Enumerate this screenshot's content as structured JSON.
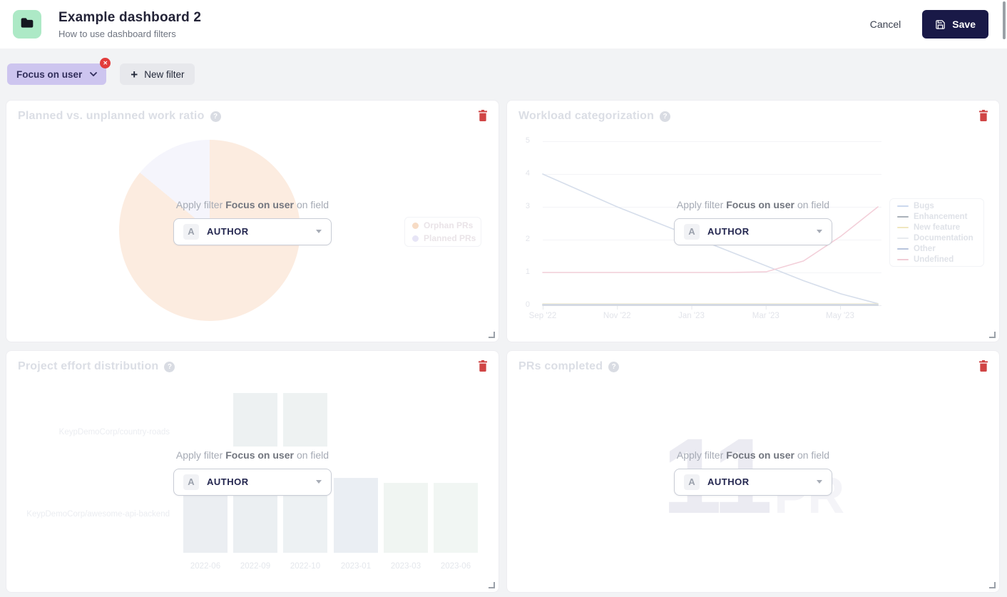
{
  "header": {
    "title": "Example dashboard 2",
    "subtitle": "How to use dashboard filters",
    "cancel_label": "Cancel",
    "save_label": "Save"
  },
  "filter_bar": {
    "chip_label": "Focus on user",
    "new_filter_label": "New filter"
  },
  "overlay": {
    "prefix": "Apply filter",
    "filter_name": "Focus on user",
    "suffix": "on field",
    "field_letter": "A",
    "field_value": "AUTHOR"
  },
  "icons": {
    "help_glyph": "?",
    "close_glyph": "✕",
    "plus_glyph": "+"
  },
  "panels": [
    {
      "title": "Planned vs. unplanned work ratio"
    },
    {
      "title": "Workload categorization"
    },
    {
      "title": "Project effort distribution"
    },
    {
      "title": "PRs completed",
      "big_value": "11",
      "big_unit": "PR"
    }
  ],
  "colors": {
    "save_button": "#191947",
    "app_icon_bg": "#ade9c6",
    "chip_bg": "#cdc5ef",
    "danger": "#d04545",
    "badge": "#e23c3c"
  },
  "chart_data": [
    {
      "panel": "Planned vs. unplanned work ratio",
      "type": "pie",
      "slices": [
        {
          "label": "Orphan PRs",
          "value": 86,
          "color": "#fcece0",
          "legend_color": "#f7dcc5"
        },
        {
          "label": "Planned PRs",
          "value": 14,
          "color": "#f5f5fc",
          "legend_color": "#e7e5f6"
        }
      ],
      "legend_position": "right"
    },
    {
      "panel": "Workload categorization",
      "type": "line",
      "x_ticks": [
        "Sep '22",
        "Nov '22",
        "Jan '23",
        "Mar '23",
        "May '23"
      ],
      "y_ticks": [
        "5",
        "4",
        "3",
        "2",
        "1",
        "0"
      ],
      "ylim": [
        0,
        5
      ],
      "grid": true,
      "legend_position": "right",
      "series": [
        {
          "name": "Bugs",
          "color": "#d6deeb",
          "legend_color": "#ccd8ee",
          "values": [
            4,
            3.5,
            3,
            2.55,
            2.1,
            1.65,
            1.2,
            0.75,
            0.35,
            0.05
          ]
        },
        {
          "name": "Enhancement",
          "color": "#c2c7ce",
          "legend_color": "#aab1ba",
          "values": [
            0,
            0,
            0,
            0,
            0,
            0,
            0,
            0,
            0,
            0
          ]
        },
        {
          "name": "New feature",
          "color": "#f2ebc9",
          "legend_color": "#f0e7c0",
          "values": [
            0.04,
            0.04,
            0.04,
            0.04,
            0.04,
            0.04,
            0.04,
            0.04,
            0.04,
            0.04
          ]
        },
        {
          "name": "Documentation",
          "color": "#eceef2",
          "legend_color": "#e8ebef",
          "values": [
            0.01,
            0.01,
            0.01,
            0.01,
            0.01,
            0.01,
            0.01,
            0.01,
            0.01,
            0.01
          ]
        },
        {
          "name": "Other",
          "color": "#ccd6e6",
          "legend_color": "#b8c5dd",
          "values": [
            0.02,
            0.02,
            0.02,
            0.02,
            0.02,
            0.02,
            0.02,
            0.02,
            0.02,
            0.02
          ]
        },
        {
          "name": "Undefined",
          "color": "#f3cfd9",
          "legend_color": "#f0ccd5",
          "values": [
            1,
            1,
            1,
            1,
            1,
            1,
            1.02,
            1.35,
            2.1,
            3
          ]
        }
      ]
    },
    {
      "panel": "Project effort distribution",
      "type": "bar",
      "categories": [
        "2022-06",
        "2022-09",
        "2022-10",
        "2023-01",
        "2023-03",
        "2023-06"
      ],
      "rows": [
        "KeypDemoCorp/country-roads",
        "KeypDemoCorp/awesome-api-backend"
      ],
      "series": [
        {
          "name": "KeypDemoCorp/country-roads",
          "values": [
            0,
            1,
            1,
            0,
            0,
            0
          ],
          "colors": [
            "",
            "#edf1f2",
            "#eef2f2",
            "",
            "",
            ""
          ]
        },
        {
          "name": "KeypDemoCorp/awesome-api-backend",
          "values": [
            1,
            1,
            1,
            0.96,
            0.9,
            0.9
          ],
          "colors": [
            "#ebeef2",
            "#ebeff2",
            "#edf1f3",
            "#eaeef3",
            "#f0f5f2",
            "#f1f6f3"
          ]
        }
      ]
    },
    {
      "panel": "PRs completed",
      "type": "big-number",
      "value": 11,
      "unit": "PR"
    }
  ]
}
